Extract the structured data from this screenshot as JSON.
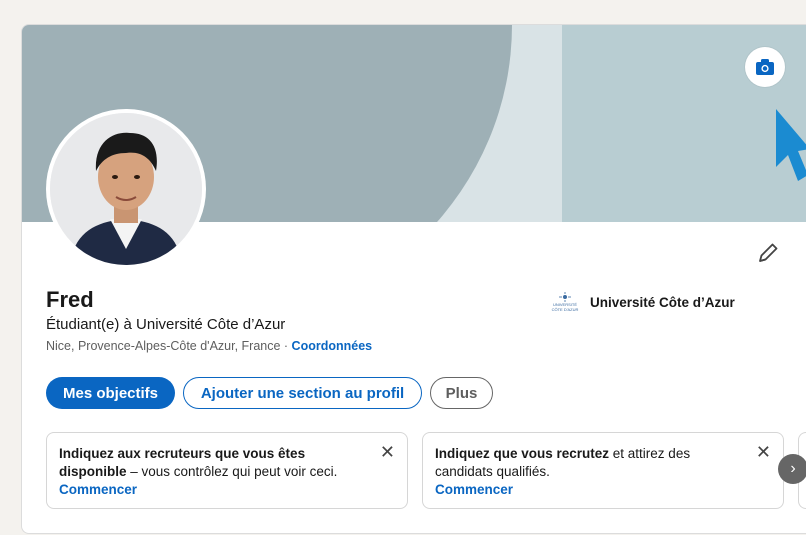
{
  "profile": {
    "name": "Fred",
    "headline": "Étudiant(e) à Université Côte d’Azur",
    "location": "Nice, Provence-Alpes-Côte d'Azur, France · ",
    "contact_link": "Coordonnées",
    "school": {
      "name": "Université Côte d’Azur",
      "logo_text_1": "UNIVERSITÉ",
      "logo_text_2": "CÔTE D'AZUR"
    }
  },
  "actions": {
    "primary": "Mes objectifs",
    "secondary": "Ajouter une section au profil",
    "more": "Plus"
  },
  "cards": [
    {
      "bold": "Indiquez aux recruteurs que vous êtes disponible",
      "rest": " – vous contrôlez qui peut voir ceci.",
      "cta": "Commencer",
      "close": "✕"
    },
    {
      "bold": "Indiquez que vous recrutez",
      "rest": " et attirez des candidats qualifiés.",
      "cta": "Commencer",
      "close": "✕"
    }
  ],
  "carousel": {
    "next": "›"
  },
  "colors": {
    "accent": "#0a66c2",
    "cursor": "#1b8bd1"
  },
  "icons": {
    "camera": "camera-icon",
    "pencil": "pencil-icon",
    "cursor": "cursor-arrow-icon"
  }
}
